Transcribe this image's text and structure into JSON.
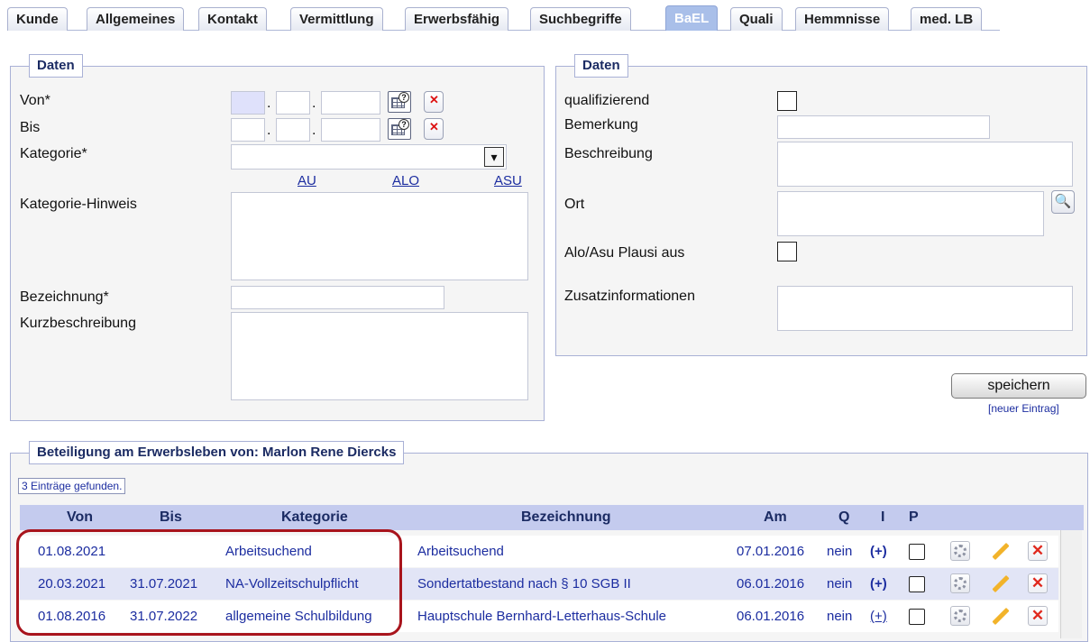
{
  "tabs": [
    {
      "label": "Kunde",
      "active": false
    },
    {
      "label": "Allgemeines",
      "active": false
    },
    {
      "label": "Kontakt",
      "active": false
    },
    {
      "label": "Vermittlung",
      "active": false
    },
    {
      "label": "Erwerbsfähig",
      "active": false
    },
    {
      "label": "Suchbegriffe",
      "active": false
    },
    {
      "label": "BaEL",
      "active": true
    },
    {
      "label": "Quali",
      "active": false
    },
    {
      "label": "Hemmnisse",
      "active": false
    },
    {
      "label": "med. LB",
      "active": false
    }
  ],
  "left_panel": {
    "legend": "Daten",
    "von_label": "Von*",
    "bis_label": "Bis",
    "kategorie_label": "Kategorie*",
    "kategorie_value": "",
    "links": [
      "AU",
      "ALO",
      "ASU"
    ],
    "kategorie_hinweis_label": "Kategorie-Hinweis",
    "bezeichnung_label": "Bezeichnung*",
    "kurzbeschreibung_label": "Kurzbeschreibung",
    "date_sep": "."
  },
  "right_panel": {
    "legend": "Daten",
    "qualifizierend_label": "qualifizierend",
    "bemerkung_label": "Bemerkung",
    "beschreibung_label": "Beschreibung",
    "ort_label": "Ort",
    "plausi_label": "Alo/Asu Plausi aus",
    "zusatz_label": "Zusatzinformationen"
  },
  "actions": {
    "save_label": "speichern",
    "new_entry_label": "[neuer Eintrag]"
  },
  "list": {
    "legend": "Beteiligung am Erwerbsleben von: Marlon Rene Diercks",
    "found_text": "3 Einträge gefunden.",
    "columns": [
      "Von",
      "Bis",
      "Kategorie",
      "Bezeichnung",
      "Am",
      "Q",
      "I",
      "P"
    ],
    "rows": [
      {
        "von": "01.08.2021",
        "bis": "",
        "kategorie": "Arbeitsuchend",
        "bezeichnung": "Arbeitsuchend",
        "am": "07.01.2016",
        "q": "nein",
        "i": "(+)"
      },
      {
        "von": "20.03.2021",
        "bis": "31.07.2021",
        "kategorie": "NA-Vollzeitschulpflicht",
        "bezeichnung": "Sondertatbestand nach § 10 SGB II",
        "am": "06.01.2016",
        "q": "nein",
        "i": "(+)"
      },
      {
        "von": "01.08.2016",
        "bis": "31.07.2022",
        "kategorie": "allgemeine Schulbildung",
        "bezeichnung": "Hauptschule Bernhard-Letterhaus-Schule",
        "am": "06.01.2016",
        "q": "nein",
        "i": "(+)"
      }
    ]
  },
  "colors": {
    "row_alt": "#e2e5f6",
    "highlight_border": "#a8141c",
    "header": "#c4cbee"
  }
}
